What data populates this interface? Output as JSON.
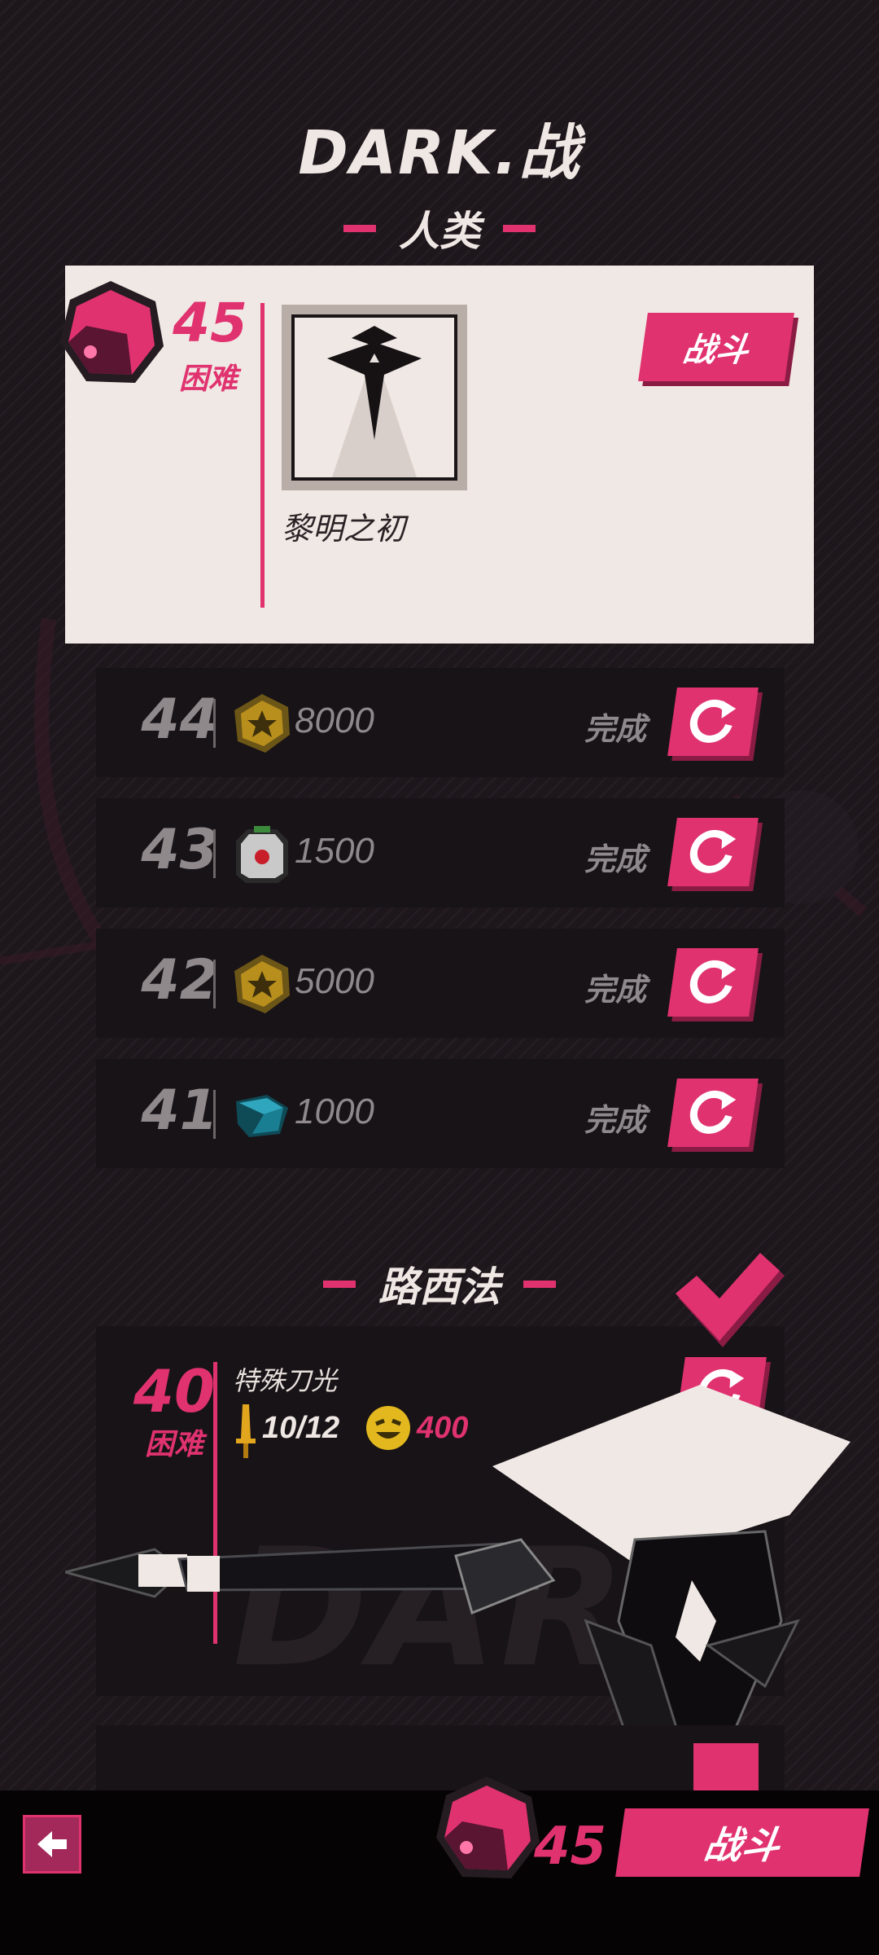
{
  "game_title": "DARK.战",
  "section_human": "人类",
  "current": {
    "level": "45",
    "difficulty": "困难",
    "reward_name": "黎明之初",
    "fight_label": "战斗"
  },
  "completed_rows": [
    {
      "level": "44",
      "reward_icon": "gold-coin-icon",
      "amount": "8000",
      "status": "完成"
    },
    {
      "level": "43",
      "reward_icon": "robot-head-icon",
      "amount": "1500",
      "status": "完成"
    },
    {
      "level": "42",
      "reward_icon": "gold-coin-icon",
      "amount": "5000",
      "status": "完成"
    },
    {
      "level": "41",
      "reward_icon": "blue-gem-icon",
      "amount": "1000",
      "status": "完成"
    }
  ],
  "section_lucifer": "路西法",
  "lucifer_stage": {
    "level": "40",
    "difficulty": "困难",
    "reward_name": "特殊刀光",
    "progress": "10/12",
    "coins": "400",
    "watermark": "DARK"
  },
  "bottom_bar": {
    "level": "45",
    "fight_label": "战斗"
  },
  "colors": {
    "accent": "#e0326f",
    "background": "#1d171c",
    "card": "#f0e8e4"
  }
}
